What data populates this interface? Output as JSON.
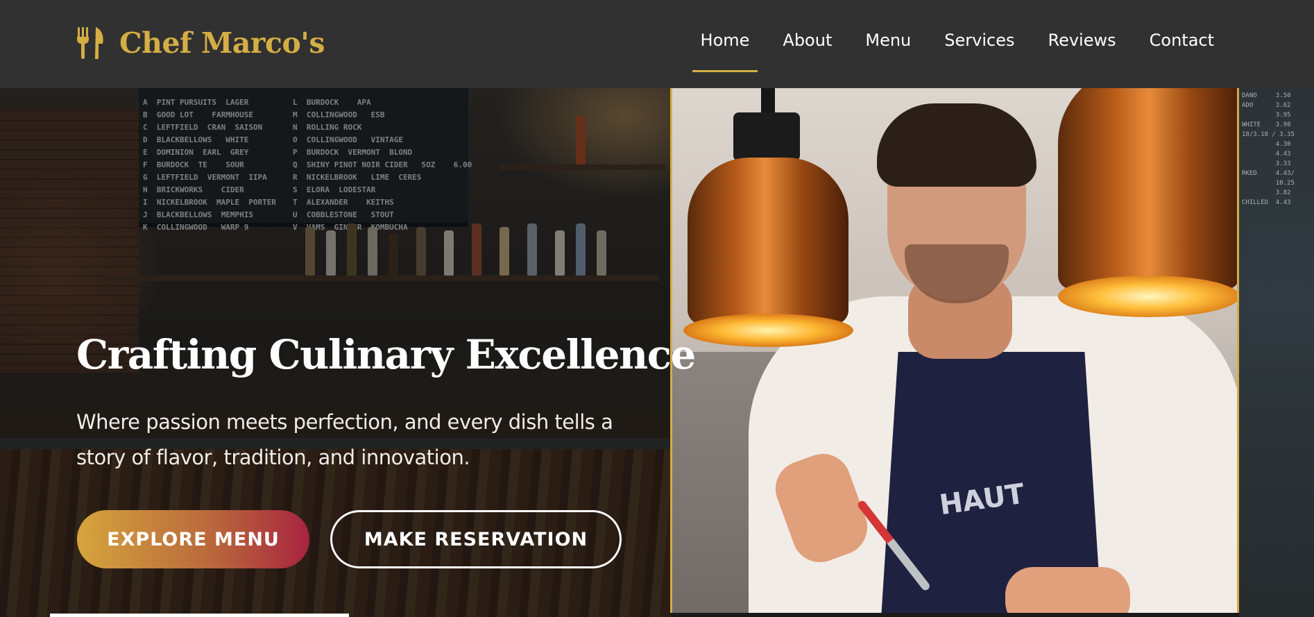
{
  "brand": {
    "name": "Chef Marco's",
    "icon": "utensils-icon",
    "color": "#d4ae45"
  },
  "nav": {
    "items": [
      {
        "label": "Home",
        "active": true
      },
      {
        "label": "About"
      },
      {
        "label": "Menu"
      },
      {
        "label": "Services"
      },
      {
        "label": "Reviews"
      },
      {
        "label": "Contact"
      }
    ]
  },
  "hero": {
    "title": "Crafting Culinary Excellence",
    "subtitle": "Where passion meets perfection, and every dish tells a story of flavor, tradition, and innovation.",
    "primary_cta": "EXPLORE MENU",
    "secondary_cta": "MAKE RESERVATION"
  },
  "chalkboard": {
    "left": "A  PINT PURSUITS  LAGER\nB  GOOD LOT    FARMHOUSE\nC  LEFTFIELD  CRAN  SAISON\nD  BLACKBELLOWS   WHITE\nE  DOMINION  EARL  GREY\nF  BURDOCK  TE    SOUR\nG  LEFTFIELD  VERMONT  IIPA\nH  BRICKWORKS    CIDER\nI  NICKELBROOK  MAPLE  PORTER\nJ  BLACKBELLOWS  MEMPHIS\nK  COLLINGWOOD   WARP 9",
    "right": "L  BURDOCK    APA\nM  COLLINGWOOD   ESB\nN  ROLLING ROCK\nO  COLLINGWOOD   VINTAGE\nP  BURDOCK  VERMONT  BLOND\nQ  SHINY PINOT NOIR CIDER   5OZ    6.00\nR  NICKELBROOK   LIME  CERES\nS  ELORA  LODESTAR\nT  ALEXANDER    KEITHS\nU  COBBLESTONE   STOUT\nV  VAMS  GINGER  KOMBUCHA"
  },
  "side_board": {
    "text": "DANO     3.50\nADO      3.62\n         3.95\nWHITE    3.98\n18/3.18 / 3.35\n         4.30\n         4.43\n         3.33\nRKED     4.43/\n         10.25\n         3.82\nCHILLED  4.43"
  },
  "colors": {
    "accent": "#d4ae45",
    "header_bg": "#323131",
    "cta_gradient_start": "#d6a53c",
    "cta_gradient_end": "#a8233e"
  }
}
